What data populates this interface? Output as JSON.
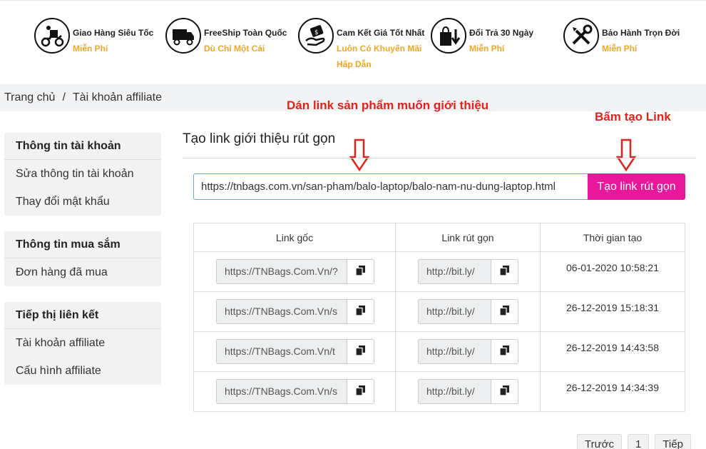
{
  "features": [
    {
      "icon": "delivery-scooter-icon",
      "title": "Giao Hàng Siêu Tốc",
      "sub": "Miễn Phí"
    },
    {
      "icon": "delivery-truck-icon",
      "title": "FreeShip Toàn Quốc",
      "sub": "Dù Chỉ Một Cái"
    },
    {
      "icon": "price-hand-icon",
      "title": "Cam Kết Giá Tốt Nhất",
      "sub": "Luôn Có Khuyến Mãi",
      "sub2": "Hấp Dẫn"
    },
    {
      "icon": "return-bag-icon",
      "title": "Đổi Trả 30 Ngày",
      "sub": "Miễn Phí"
    },
    {
      "icon": "tools-icon",
      "title": "Bảo Hành Trọn Đời",
      "sub": "Miễn Phí"
    }
  ],
  "breadcrumb": {
    "home": "Trang chủ",
    "sep": "/",
    "current": "Tài khoản affiliate"
  },
  "annotations": {
    "paste": "Dán link sản phẩm muốn giới thiệu",
    "click": "Bấm tạo Link"
  },
  "sidebar": {
    "account": {
      "heading": "Thông tin tài khoản",
      "items": [
        "Sửa thông tin tài khoản",
        "Thay đổi mật khẩu"
      ]
    },
    "shopping": {
      "heading": "Thông tin mua sắm",
      "items": [
        "Đơn hàng đã mua"
      ]
    },
    "affiliate": {
      "heading": "Tiếp thị liên kết",
      "items": [
        "Tài khoản affiliate",
        "Cấu hình affiliate"
      ]
    }
  },
  "main": {
    "title": "Tạo link giới thiệu rút gọn",
    "url_value": "https://tnbags.com.vn/san-pham/balo-laptop/balo-nam-nu-dung-laptop.html",
    "create_button": "Tạo link rút gọn"
  },
  "table": {
    "headers": [
      "Link gốc",
      "Link rút gọn",
      "Thời gian tạo"
    ],
    "rows": [
      {
        "orig": "https://TNBags.Com.Vn/?",
        "short": "http://bit.ly/",
        "time": "06-01-2020 10:58:21"
      },
      {
        "orig": "https://TNBags.Com.Vn/s",
        "short": "http://bit.ly/",
        "time": "26-12-2019 15:18:31"
      },
      {
        "orig": "https://TNBags.Com.Vn/t",
        "short": "http://bit.ly/",
        "time": "26-12-2019 14:43:58"
      },
      {
        "orig": "https://TNBags.Com.Vn/s",
        "short": "http://bit.ly/",
        "time": "26-12-2019 14:34:39"
      }
    ]
  },
  "pagination": {
    "prev": "Trước",
    "page": "1",
    "next": "Tiếp"
  },
  "colors": {
    "accent": "#e8179b",
    "annotation": "#e4211c",
    "highlight": "#f5a623"
  }
}
